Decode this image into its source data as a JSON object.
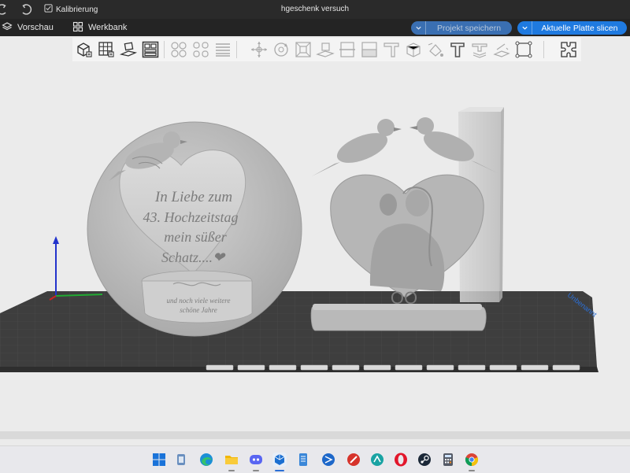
{
  "titlebar": {
    "calibration_label": "Kalibrierung",
    "project_title": "hgeschenk versuch"
  },
  "menubar": {
    "preview_tab": "Vorschau",
    "workbench_tab": "Werkbank",
    "save_project_label": "Projekt speichern",
    "slice_plate_label": "Aktuelle Platte slicen"
  },
  "models": {
    "plaque_text": [
      "In Liebe zum",
      "43. Hochzeitstag",
      "mein süßer",
      "Schatz....❤"
    ],
    "base_text": [
      "und noch viele weitere",
      "schöne Jahre"
    ],
    "rings_text": "OO",
    "plate_label": "Unbenannt"
  },
  "colors": {
    "accent": "#1f7ae0",
    "titlebar": "#2a2a2a",
    "menubar": "#242424",
    "plate": "#3e3e3e",
    "model": "#b9b9b9"
  },
  "taskbar_icons": [
    "windows-start-icon",
    "file-manager-icon",
    "edge-browser-icon",
    "folder-icon",
    "discord-icon",
    "slicer-app-icon",
    "notepad-icon",
    "sourcetree-icon",
    "app-red-icon",
    "app-teal-icon",
    "opera-icon",
    "steam-icon",
    "calculator-icon",
    "chrome-icon"
  ]
}
